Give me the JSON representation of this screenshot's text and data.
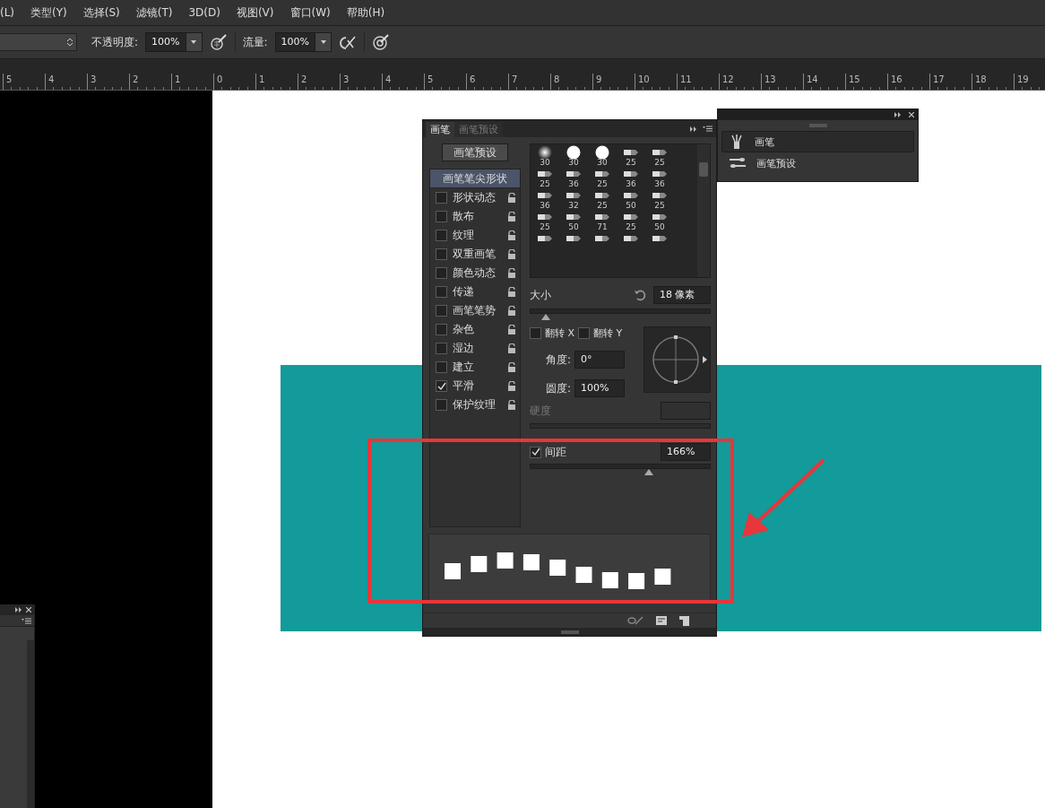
{
  "menu_bar": {
    "items": [
      "(L)",
      "类型(Y)",
      "选择(S)",
      "滤镜(T)",
      "3D(D)",
      "视图(V)",
      "窗口(W)",
      "帮助(H)"
    ]
  },
  "options_bar": {
    "opacity": {
      "label": "不透明度:",
      "value": "100%"
    },
    "flow": {
      "label": "流量:",
      "value": "100%"
    }
  },
  "ruler": {
    "ticks": [
      "5",
      "4",
      "3",
      "2",
      "1",
      "0",
      "1",
      "2",
      "3",
      "4",
      "5",
      "6",
      "7",
      "8",
      "9",
      "10",
      "11",
      "12",
      "13",
      "14",
      "15",
      "16",
      "17",
      "18",
      "19"
    ]
  },
  "brush_panel": {
    "tabs": [
      {
        "label": "画笔",
        "selected": true
      },
      {
        "label": "画笔预设",
        "selected": false
      }
    ],
    "preset_button": "画笔预设",
    "tip_shape": {
      "label": "画笔笔尖形状",
      "selected": true
    },
    "options": [
      {
        "label": "形状动态",
        "checked": false
      },
      {
        "label": "散布",
        "checked": false
      },
      {
        "label": "纹理",
        "checked": false
      },
      {
        "label": "双重画笔",
        "checked": false
      },
      {
        "label": "颜色动态",
        "checked": false
      },
      {
        "label": "传递",
        "checked": false
      },
      {
        "label": "画笔笔势",
        "checked": false
      },
      {
        "label": "杂色",
        "checked": false
      },
      {
        "label": "湿边",
        "checked": false
      },
      {
        "label": "建立",
        "checked": false
      },
      {
        "label": "平滑",
        "checked": true
      },
      {
        "label": "保护纹理",
        "checked": false
      }
    ],
    "brushes": [
      {
        "kind": "soft",
        "size": "30"
      },
      {
        "kind": "hard",
        "size": "30"
      },
      {
        "kind": "hard",
        "size": "30"
      },
      {
        "kind": "tip",
        "size": "25"
      },
      {
        "kind": "tip",
        "size": "25"
      },
      {
        "kind": "tip",
        "size": "25"
      },
      {
        "kind": "tip",
        "size": "36"
      },
      {
        "kind": "tip",
        "size": "25"
      },
      {
        "kind": "tip",
        "size": "36"
      },
      {
        "kind": "tip",
        "size": "36"
      },
      {
        "kind": "tip",
        "size": "36"
      },
      {
        "kind": "tip",
        "size": "32"
      },
      {
        "kind": "tip",
        "size": "25"
      },
      {
        "kind": "tip",
        "size": "50"
      },
      {
        "kind": "tip",
        "size": "25"
      },
      {
        "kind": "tip",
        "size": "25"
      },
      {
        "kind": "tip",
        "size": "50"
      },
      {
        "kind": "tip",
        "size": "71"
      },
      {
        "kind": "tip",
        "size": "25"
      },
      {
        "kind": "tip",
        "size": "50"
      },
      {
        "kind": "tip"
      },
      {
        "kind": "tip"
      },
      {
        "kind": "tip"
      },
      {
        "kind": "tip"
      },
      {
        "kind": "tip"
      }
    ],
    "size": {
      "label": "大小",
      "value": "18 像素",
      "level": 0.09
    },
    "flip_x": {
      "label": "翻转 X",
      "checked": false
    },
    "flip_y": {
      "label": "翻转 Y",
      "checked": false
    },
    "angle": {
      "label": "角度:",
      "value": "0°"
    },
    "roundness": {
      "label": "圆度:",
      "value": "100%"
    },
    "hardness": {
      "label": "硬度",
      "disabled": true
    },
    "spacing": {
      "label": "间距",
      "checked": true,
      "value": "166%",
      "level": 0.66
    }
  },
  "mini_panel": {
    "items": [
      {
        "label": "画笔",
        "selected": true
      },
      {
        "label": "画笔预设",
        "selected": false
      }
    ]
  }
}
